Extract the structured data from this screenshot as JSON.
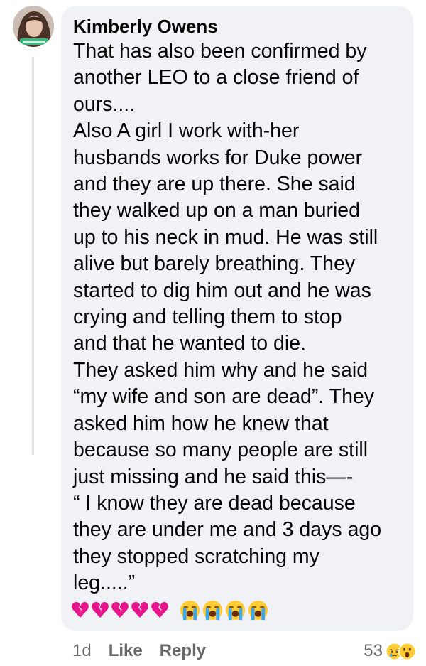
{
  "comment": {
    "author": "Kimberly Owens",
    "lines": [
      "That has also been confirmed by",
      "another LEO to a close friend of",
      "ours....",
      "Also A girl I work with-her",
      "husbands works for Duke power",
      "and they are up there. She said",
      "they walked up on a man buried",
      "up to his neck in mud. He was still",
      "alive but barely breathing. They",
      "started to dig him out and he was",
      "crying and telling them to stop",
      "and that he wanted to die.",
      "They asked him why and he said",
      "“my wife and son are dead”. They",
      "asked him how he knew that",
      "because so many people are still",
      "just missing and he said this—-",
      "“ I know they are dead because",
      "they are under me and 3 days ago",
      "they stopped scratching my",
      "leg.....”"
    ],
    "emojis": [
      "broken-heart",
      "broken-heart",
      "broken-heart",
      "broken-heart",
      "broken-heart",
      "loudly-crying-face",
      "loudly-crying-face",
      "loudly-crying-face",
      "loudly-crying-face"
    ]
  },
  "actions": {
    "time": "1d",
    "like_label": "Like",
    "reply_label": "Reply"
  },
  "reactions": {
    "count": "53",
    "icons": [
      "sad-reaction",
      "wow-reaction"
    ]
  },
  "colors": {
    "bubble": "#f0f2f5",
    "text": "#050505",
    "secondary": "#65676b",
    "heart": "#e8148c",
    "emoji_yellow": "#ffcc33",
    "tears": "#3fa7f0"
  }
}
